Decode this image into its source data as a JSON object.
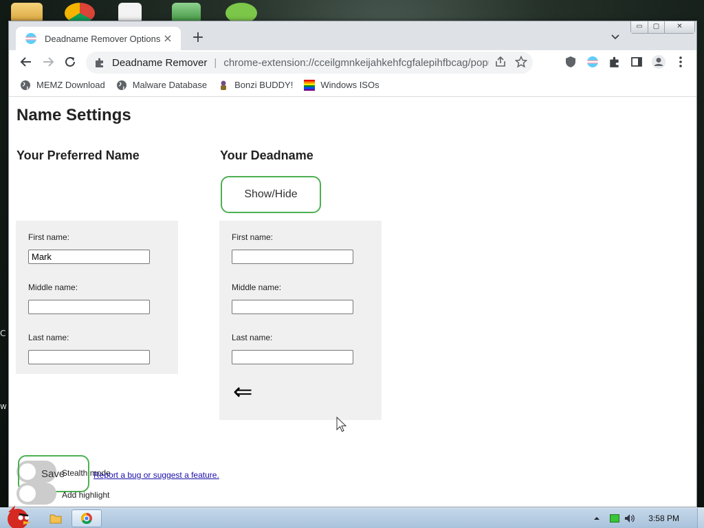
{
  "tab": {
    "title": "Deadname Remover Options",
    "close_glyph": "×",
    "new_tab_glyph": "+"
  },
  "window_controls": {
    "minimize": "▭",
    "maximize": "▢",
    "close": "✕"
  },
  "omnibox": {
    "extension_name": "Deadname Remover",
    "separator": "|",
    "url": "chrome-extension://cceilgmnkeijahkehfcgfalepihfbcag/popup..."
  },
  "bookmarks": [
    {
      "label": "MEMZ Download",
      "icon": "globe-icon"
    },
    {
      "label": "Malware Database",
      "icon": "globe-icon"
    },
    {
      "label": "Bonzi BUDDY!",
      "icon": "bonzi-icon"
    },
    {
      "label": "Windows ISOs",
      "icon": "rainbow-flag-icon"
    }
  ],
  "page": {
    "title": "Name Settings",
    "preferred": {
      "heading": "Your Preferred Name",
      "first_label": "First name:",
      "first_value": "Mark",
      "middle_label": "Middle name:",
      "middle_value": "",
      "last_label": "Last name:",
      "last_value": ""
    },
    "deadname": {
      "heading": "Your Deadname",
      "show_hide_label": "Show/Hide",
      "first_label": "First name:",
      "first_value": "",
      "middle_label": "Middle name:",
      "middle_value": "",
      "last_label": "Last name:",
      "last_value": "",
      "arrow_glyph": "⇐"
    },
    "stealth_label": "Stealth mode",
    "highlight_label": "Add highlight",
    "save_label": "Save",
    "report_link": "Report a bug or suggest a feature."
  },
  "desktop_side_text": {
    "c": "C",
    "w": "w"
  },
  "taskbar": {
    "clock": "3:58 PM"
  },
  "colors": {
    "accent_green": "#4caf50",
    "panel_bg": "#f0f0f0",
    "link": "#1a0dab"
  }
}
